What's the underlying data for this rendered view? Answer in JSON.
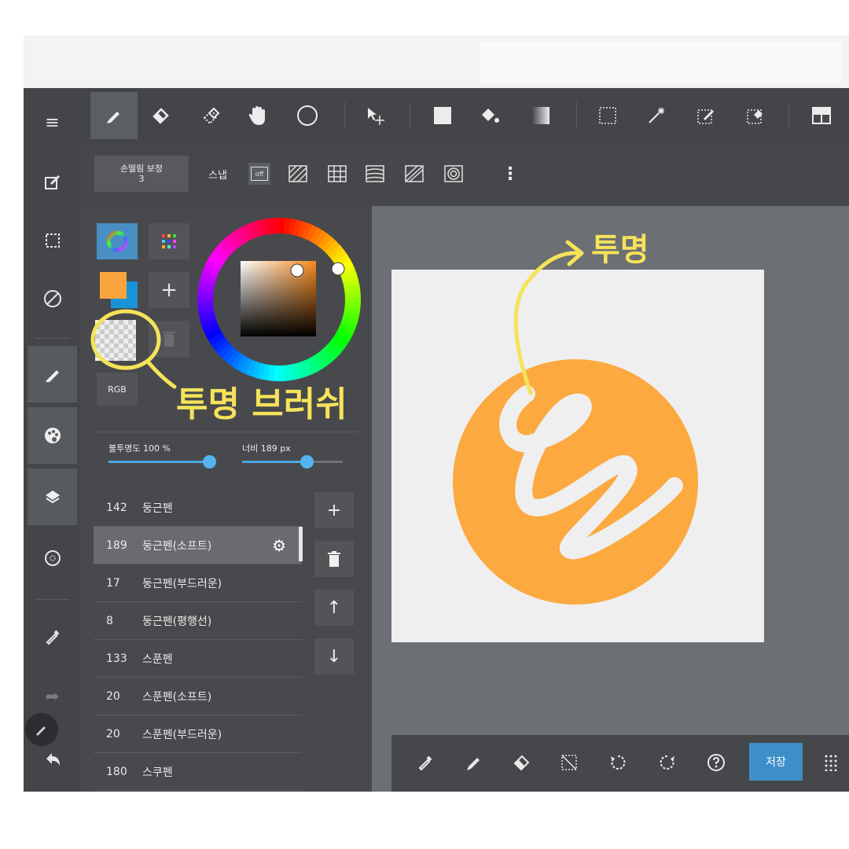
{
  "toolbar": {
    "items": [
      {
        "name": "pen-tool",
        "glyph": "✎"
      },
      {
        "name": "eraser-tool",
        "glyph": "◆"
      },
      {
        "name": "blur-tool",
        "glyph": "◇"
      },
      {
        "name": "hand-tool",
        "glyph": "✋"
      },
      {
        "name": "ellipse-tool",
        "glyph": "○"
      },
      {
        "name": "move-tool",
        "glyph": "➚"
      },
      {
        "name": "fill-rect-tool",
        "glyph": "■"
      },
      {
        "name": "bucket-tool",
        "glyph": "◈"
      },
      {
        "name": "gradient-tool",
        "glyph": "▆"
      },
      {
        "name": "select-rect-tool",
        "glyph": "⬚"
      },
      {
        "name": "magic-wand-tool",
        "glyph": "✶"
      },
      {
        "name": "select-pen-tool",
        "glyph": "⊡"
      },
      {
        "name": "select-eraser-tool",
        "glyph": "⊠"
      },
      {
        "name": "frame-tool",
        "glyph": "▦"
      }
    ]
  },
  "options": {
    "stabilizer_label": "손떨림 보정",
    "stabilizer_value": "3",
    "snap_label": "스냅",
    "snap_off": "off",
    "more": "⋮"
  },
  "color_panel": {
    "wheel_tab": "color-wheel",
    "palette_tab": "palette",
    "add": "+",
    "rgb_label": "RGB",
    "opacity_label": "불투명도 100 %",
    "opacity_value": 100,
    "width_label": "너비 189 px",
    "width_value": 189,
    "main_color": "#f9a43d",
    "sub_color": "#1a93d6"
  },
  "brushes": [
    {
      "size": "142",
      "name": "둥근펜"
    },
    {
      "size": "189",
      "name": "둥근펜(소프트)",
      "selected": true
    },
    {
      "size": "17",
      "name": "둥근펜(부드러운)"
    },
    {
      "size": "8",
      "name": "둥근펜(평행선)"
    },
    {
      "size": "133",
      "name": "스푼펜"
    },
    {
      "size": "20",
      "name": "스푼펜(소프트)"
    },
    {
      "size": "20",
      "name": "스푼펜(부드러운)"
    },
    {
      "size": "180",
      "name": "스쿠펜"
    }
  ],
  "list_buttons": {
    "add": "+",
    "delete": "🗑",
    "up": "↑",
    "down": "↓"
  },
  "bottom_bar": {
    "save_label": "저장"
  },
  "annotations": {
    "top": "투명",
    "swatch": "투명 브러쉬"
  },
  "colors": {
    "accent": "#4aa6e0",
    "circle": "#fca940",
    "annotation": "#f5e35a"
  }
}
